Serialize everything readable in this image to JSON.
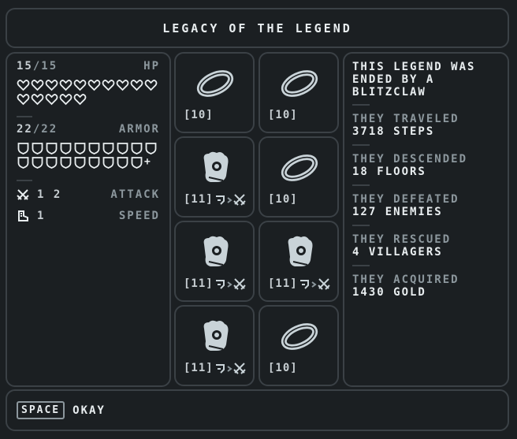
{
  "title": "LEGACY OF THE LEGEND",
  "stats": {
    "hp": {
      "current": "15",
      "max": "/15",
      "label": "HP",
      "heart_count": 15
    },
    "armor": {
      "current": "22",
      "max": "/22",
      "label": "ARMOR",
      "shield_count": 19,
      "extra": "+"
    },
    "attack": {
      "value": "1 2",
      "label": "ATTACK",
      "icon": "crossed-swords-icon"
    },
    "speed": {
      "value": "1",
      "label": "SPEED",
      "icon": "boot-icon"
    }
  },
  "items": [
    {
      "type": "ring",
      "value": "[10]",
      "icon": "ring-icon",
      "combo": false
    },
    {
      "type": "ring",
      "value": "[10]",
      "icon": "ring-icon",
      "combo": false
    },
    {
      "type": "gauntlet",
      "value": "[11]",
      "icon": "gauntlet-icon",
      "combo": true
    },
    {
      "type": "ring",
      "value": "[10]",
      "icon": "ring-icon",
      "combo": false
    },
    {
      "type": "gauntlet",
      "value": "[11]",
      "icon": "gauntlet-icon",
      "combo": true
    },
    {
      "type": "gauntlet",
      "value": "[11]",
      "icon": "gauntlet-icon",
      "combo": true
    },
    {
      "type": "gauntlet",
      "value": "[11]",
      "icon": "gauntlet-icon",
      "combo": true
    },
    {
      "type": "ring",
      "value": "[10]",
      "icon": "ring-icon",
      "combo": false
    }
  ],
  "legend": {
    "ending": "THIS LEGEND WAS ENDED BY A BLITZCLAW",
    "entries": [
      {
        "heading": "THEY TRAVELED",
        "value": "3718 STEPS"
      },
      {
        "heading": "THEY DESCENDED",
        "value": "18 FLOORS"
      },
      {
        "heading": "THEY DEFEATED",
        "value": "127 ENEMIES"
      },
      {
        "heading": "THEY RESCUED",
        "value": "4 VILLAGERS"
      },
      {
        "heading": "THEY ACQUIRED",
        "value": "1430 GOLD"
      }
    ]
  },
  "footer": {
    "key": "SPACE",
    "action": "OKAY"
  },
  "colors": {
    "background": "#1b1f22",
    "border": "#3b4146",
    "text": "#e9eef0",
    "muted": "#8c979d",
    "item": "#c9d3d8"
  }
}
